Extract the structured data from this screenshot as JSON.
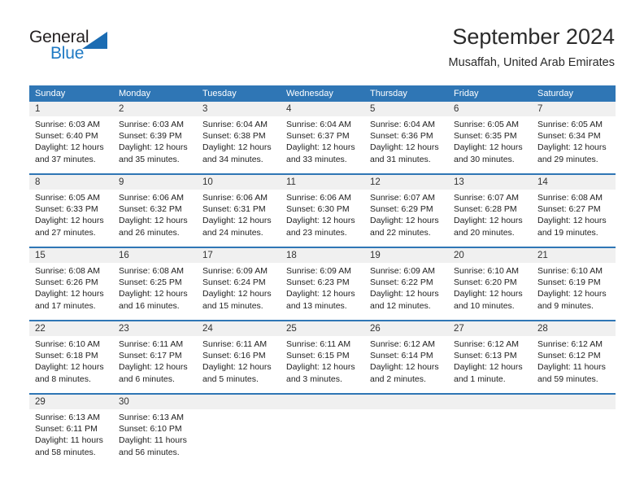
{
  "brand": {
    "name_top": "General",
    "name_bottom": "Blue",
    "triangle_icon": "blue-triangle-icon",
    "accent_color": "#1b6cb3"
  },
  "header": {
    "title": "September 2024",
    "subtitle": "Musaffah, United Arab Emirates"
  },
  "calendar": {
    "header_bg": "#2f76b5",
    "daynum_bg": "#f0f0f0",
    "weekday_names": [
      "Sunday",
      "Monday",
      "Tuesday",
      "Wednesday",
      "Thursday",
      "Friday",
      "Saturday"
    ],
    "weeks": [
      [
        {
          "day": "1",
          "lines": [
            "Sunrise: 6:03 AM",
            "Sunset: 6:40 PM",
            "Daylight: 12 hours",
            "and 37 minutes."
          ]
        },
        {
          "day": "2",
          "lines": [
            "Sunrise: 6:03 AM",
            "Sunset: 6:39 PM",
            "Daylight: 12 hours",
            "and 35 minutes."
          ]
        },
        {
          "day": "3",
          "lines": [
            "Sunrise: 6:04 AM",
            "Sunset: 6:38 PM",
            "Daylight: 12 hours",
            "and 34 minutes."
          ]
        },
        {
          "day": "4",
          "lines": [
            "Sunrise: 6:04 AM",
            "Sunset: 6:37 PM",
            "Daylight: 12 hours",
            "and 33 minutes."
          ]
        },
        {
          "day": "5",
          "lines": [
            "Sunrise: 6:04 AM",
            "Sunset: 6:36 PM",
            "Daylight: 12 hours",
            "and 31 minutes."
          ]
        },
        {
          "day": "6",
          "lines": [
            "Sunrise: 6:05 AM",
            "Sunset: 6:35 PM",
            "Daylight: 12 hours",
            "and 30 minutes."
          ]
        },
        {
          "day": "7",
          "lines": [
            "Sunrise: 6:05 AM",
            "Sunset: 6:34 PM",
            "Daylight: 12 hours",
            "and 29 minutes."
          ]
        }
      ],
      [
        {
          "day": "8",
          "lines": [
            "Sunrise: 6:05 AM",
            "Sunset: 6:33 PM",
            "Daylight: 12 hours",
            "and 27 minutes."
          ]
        },
        {
          "day": "9",
          "lines": [
            "Sunrise: 6:06 AM",
            "Sunset: 6:32 PM",
            "Daylight: 12 hours",
            "and 26 minutes."
          ]
        },
        {
          "day": "10",
          "lines": [
            "Sunrise: 6:06 AM",
            "Sunset: 6:31 PM",
            "Daylight: 12 hours",
            "and 24 minutes."
          ]
        },
        {
          "day": "11",
          "lines": [
            "Sunrise: 6:06 AM",
            "Sunset: 6:30 PM",
            "Daylight: 12 hours",
            "and 23 minutes."
          ]
        },
        {
          "day": "12",
          "lines": [
            "Sunrise: 6:07 AM",
            "Sunset: 6:29 PM",
            "Daylight: 12 hours",
            "and 22 minutes."
          ]
        },
        {
          "day": "13",
          "lines": [
            "Sunrise: 6:07 AM",
            "Sunset: 6:28 PM",
            "Daylight: 12 hours",
            "and 20 minutes."
          ]
        },
        {
          "day": "14",
          "lines": [
            "Sunrise: 6:08 AM",
            "Sunset: 6:27 PM",
            "Daylight: 12 hours",
            "and 19 minutes."
          ]
        }
      ],
      [
        {
          "day": "15",
          "lines": [
            "Sunrise: 6:08 AM",
            "Sunset: 6:26 PM",
            "Daylight: 12 hours",
            "and 17 minutes."
          ]
        },
        {
          "day": "16",
          "lines": [
            "Sunrise: 6:08 AM",
            "Sunset: 6:25 PM",
            "Daylight: 12 hours",
            "and 16 minutes."
          ]
        },
        {
          "day": "17",
          "lines": [
            "Sunrise: 6:09 AM",
            "Sunset: 6:24 PM",
            "Daylight: 12 hours",
            "and 15 minutes."
          ]
        },
        {
          "day": "18",
          "lines": [
            "Sunrise: 6:09 AM",
            "Sunset: 6:23 PM",
            "Daylight: 12 hours",
            "and 13 minutes."
          ]
        },
        {
          "day": "19",
          "lines": [
            "Sunrise: 6:09 AM",
            "Sunset: 6:22 PM",
            "Daylight: 12 hours",
            "and 12 minutes."
          ]
        },
        {
          "day": "20",
          "lines": [
            "Sunrise: 6:10 AM",
            "Sunset: 6:20 PM",
            "Daylight: 12 hours",
            "and 10 minutes."
          ]
        },
        {
          "day": "21",
          "lines": [
            "Sunrise: 6:10 AM",
            "Sunset: 6:19 PM",
            "Daylight: 12 hours",
            "and 9 minutes."
          ]
        }
      ],
      [
        {
          "day": "22",
          "lines": [
            "Sunrise: 6:10 AM",
            "Sunset: 6:18 PM",
            "Daylight: 12 hours",
            "and 8 minutes."
          ]
        },
        {
          "day": "23",
          "lines": [
            "Sunrise: 6:11 AM",
            "Sunset: 6:17 PM",
            "Daylight: 12 hours",
            "and 6 minutes."
          ]
        },
        {
          "day": "24",
          "lines": [
            "Sunrise: 6:11 AM",
            "Sunset: 6:16 PM",
            "Daylight: 12 hours",
            "and 5 minutes."
          ]
        },
        {
          "day": "25",
          "lines": [
            "Sunrise: 6:11 AM",
            "Sunset: 6:15 PM",
            "Daylight: 12 hours",
            "and 3 minutes."
          ]
        },
        {
          "day": "26",
          "lines": [
            "Sunrise: 6:12 AM",
            "Sunset: 6:14 PM",
            "Daylight: 12 hours",
            "and 2 minutes."
          ]
        },
        {
          "day": "27",
          "lines": [
            "Sunrise: 6:12 AM",
            "Sunset: 6:13 PM",
            "Daylight: 12 hours",
            "and 1 minute."
          ]
        },
        {
          "day": "28",
          "lines": [
            "Sunrise: 6:12 AM",
            "Sunset: 6:12 PM",
            "Daylight: 11 hours",
            "and 59 minutes."
          ]
        }
      ],
      [
        {
          "day": "29",
          "lines": [
            "Sunrise: 6:13 AM",
            "Sunset: 6:11 PM",
            "Daylight: 11 hours",
            "and 58 minutes."
          ]
        },
        {
          "day": "30",
          "lines": [
            "Sunrise: 6:13 AM",
            "Sunset: 6:10 PM",
            "Daylight: 11 hours",
            "and 56 minutes."
          ]
        },
        {
          "day": "",
          "lines": []
        },
        {
          "day": "",
          "lines": []
        },
        {
          "day": "",
          "lines": []
        },
        {
          "day": "",
          "lines": []
        },
        {
          "day": "",
          "lines": []
        }
      ]
    ]
  }
}
